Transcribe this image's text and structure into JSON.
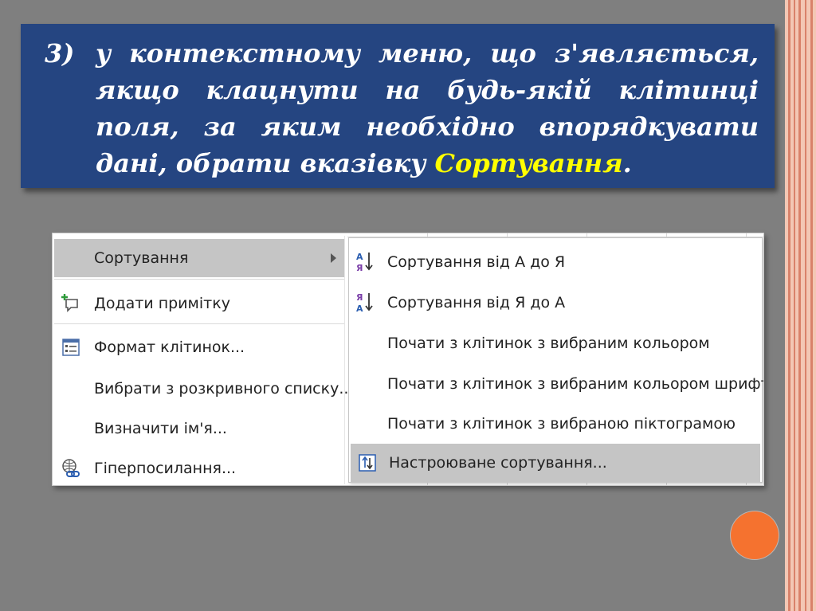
{
  "slide": {
    "number": "3)",
    "text_before": "у контекстному меню, що з'являється, якщо клацнути на будь-якій клітинці поля, за яким необхідно впорядкувати дані, обрати вказівку ",
    "highlight": "Сортування",
    "text_after": ".",
    "colors": {
      "background": "#7f7f7f",
      "box": "#254581",
      "highlight": "#ffff00",
      "accent_circle": "#f5722f"
    }
  },
  "context_menu": {
    "items": [
      {
        "label": "Сортування",
        "icon": "none",
        "selected": true,
        "has_submenu": true
      },
      {
        "label": "Додати примітку",
        "icon": "add-comment-icon"
      },
      {
        "label": "Формат клітинок...",
        "icon": "format-cells-icon"
      },
      {
        "label": "Вибрати з розкривного списку...",
        "icon": "none"
      },
      {
        "label": "Визначити ім'я...",
        "icon": "none"
      },
      {
        "label": "Гіперпосилання...",
        "icon": "hyperlink-icon"
      }
    ]
  },
  "sort_submenu": {
    "items": [
      {
        "label": "Сортування від А до Я",
        "icon": "sort-a-z-icon",
        "icon_text": [
          "А",
          "Я"
        ]
      },
      {
        "label": "Сортування від Я до А",
        "icon": "sort-z-a-icon",
        "icon_text": [
          "Я",
          "А"
        ]
      },
      {
        "label": "Почати з клітинок з вибраним кольором",
        "icon": "none"
      },
      {
        "label": "Почати з клітинок з вибраним кольором шрифту",
        "icon": "none"
      },
      {
        "label": "Почати з клітинок з вибраною піктограмою",
        "icon": "none"
      },
      {
        "label": "Настроюване сортування...",
        "icon": "custom-sort-icon",
        "selected": true
      }
    ]
  }
}
